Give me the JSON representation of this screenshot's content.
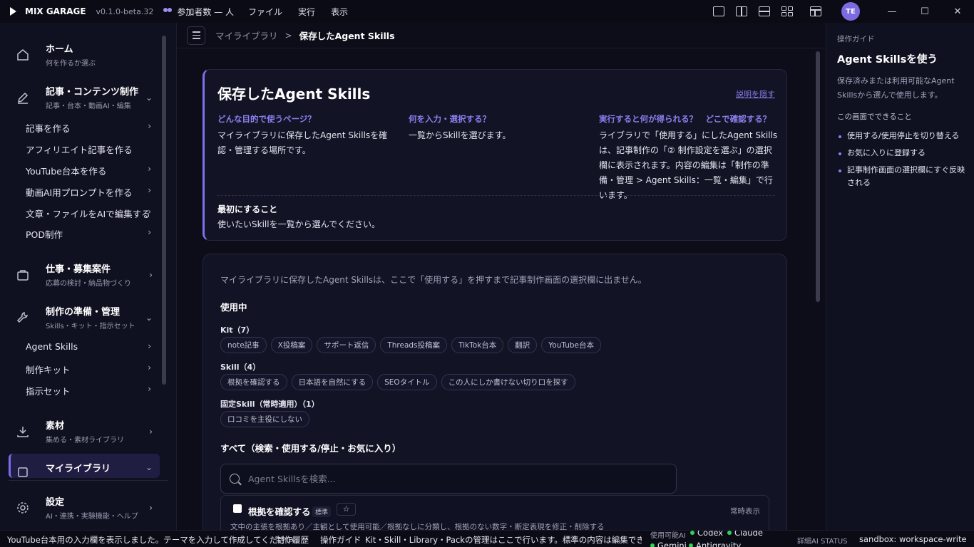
{
  "titlebar": {
    "app_name": "MIX GARAGE",
    "version": "v0.1.0-beta.32",
    "participants": "参加者数 — 人",
    "menus": [
      "ファイル",
      "実行",
      "表示"
    ],
    "avatar_initials": "TE"
  },
  "sidebar": {
    "groups": [
      {
        "title": "ホーム",
        "sub": "何を作るか選ぶ",
        "icon": "home-icon"
      },
      {
        "title": "記事・コンテンツ制作",
        "sub": "記事・台本・動画AI・編集",
        "icon": "pen-icon"
      },
      {
        "title": "仕事・募集案件",
        "sub": "応募の検討・納品物づくり",
        "icon": "briefcase-icon"
      },
      {
        "title": "制作の準備・管理",
        "sub": "Skills・キット・指示セット",
        "icon": "wrench-icon"
      },
      {
        "title": "素材",
        "sub": "集める・素材ライブラリ",
        "icon": "download-icon"
      },
      {
        "title": "マイライブラリ",
        "sub": "",
        "icon": "library-icon"
      },
      {
        "title": "設定",
        "sub": "AI・連携・実験機能・ヘルプ",
        "icon": "gear-icon"
      }
    ],
    "content_items": [
      "記事を作る",
      "アフィリエイト記事を作る",
      "YouTube台本を作る",
      "動画AI用プロンプトを作る",
      "文章・ファイルをAIで編集する",
      "POD制作"
    ],
    "prep_items": [
      "Agent Skills",
      "制作キット",
      "指示セット"
    ]
  },
  "breadcrumb": {
    "parent": "マイライブラリ",
    "sep": ">",
    "current": "保存したAgent Skills"
  },
  "intro": {
    "title": "保存したAgent Skills",
    "hide_link": "説明を隠す",
    "col1_head": "どんな目的で使うページ？",
    "col1_text": "マイライブラリに保存したAgent Skillsを確認・管理する場所です。",
    "col2_head": "何を入力・選択する？",
    "col2_text": "一覧からSkillを選びます。",
    "col3_head": "実行すると何が得られる？　どこで確認する？",
    "col3_text": "ライブラリで「使用する」にしたAgent Skillsは、記事制作の「② 制作設定を選ぶ」の選択欄に表示されます。内容の編集は「制作の準備・管理 > Agent Skills：一覧・編集」で行います。",
    "first_head": "最初にすること",
    "first_text": "使いたいSkillを一覧から選んでください。"
  },
  "library": {
    "notice": "マイライブラリに保存したAgent Skillsは、ここで「使用する」を押すまで記事制作画面の選択欄に出ません。",
    "in_use_label": "使用中",
    "kit_label": "Kit（7）",
    "kit_chips": [
      "note記事",
      "X投稿案",
      "サポート返信",
      "Threads投稿案",
      "TikTok台本",
      "翻訳",
      "YouTube台本"
    ],
    "skill_label": "Skill（4）",
    "skill_chips": [
      "根拠を確認する",
      "日本語を自然にする",
      "SEOタイトル",
      "この人にしか書けない切り口を探す"
    ],
    "fixed_label": "固定Skill（常時適用）（1）",
    "fixed_chips": [
      "口コミを主役にしない"
    ],
    "all_label": "すべて（検索・使用する/停止・お気に入り）",
    "search_placeholder": "Agent Skillsを検索...",
    "item": {
      "name": "根拠を確認する",
      "badge": "標準",
      "star": "☆",
      "always": "常時表示",
      "desc": "文中の主張を根拠あり／主観として使用可能／根拠なしに分類し、根拠のない数字・断定表現を修正・削除する"
    }
  },
  "guide": {
    "header": "操作ガイド",
    "title": "Agent Skillsを使う",
    "desc": "保存済みまたは利用可能なAgent Skillsから選んで使用します。",
    "sub": "この画面でできること",
    "items": [
      "使用する/使用停止を切り替える",
      "お気に入りに登録する",
      "記事制作画面の選択欄にすぐ反映される"
    ]
  },
  "status": {
    "message": "YouTube台本用の入力欄を表示しました。テーマを入力して作成してください。",
    "history": "制作履歴",
    "guide": "操作ガイド",
    "mgmt": "Kit・Skill・Library・Packの管理はここで行います。標準の内容は編集できません（複",
    "ai_label": "使用可能AI",
    "ais": [
      "Codex",
      "Claude",
      "Gemini",
      "Antigravity"
    ],
    "detail": "詳細AI STATUS",
    "sandbox": "sandbox: workspace-write"
  },
  "colors": {
    "accent": "#8070f0",
    "bg": "#0c0d18",
    "ok": "#34d058"
  }
}
